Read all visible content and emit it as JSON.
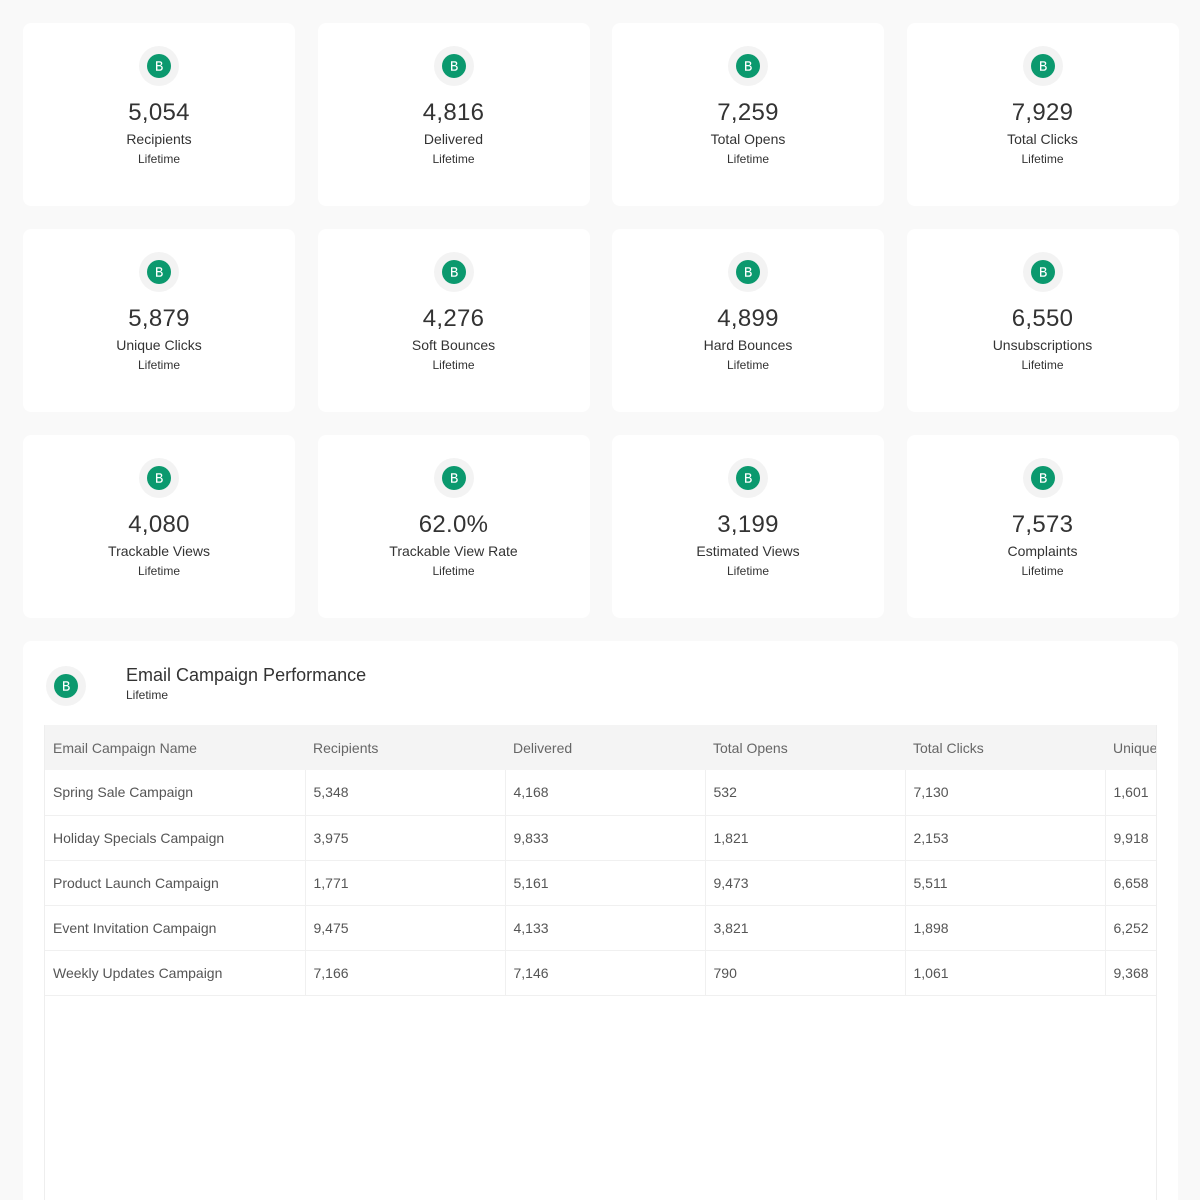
{
  "brand": {
    "accent": "#0b996e",
    "icon": "b-logo-icon"
  },
  "stats": [
    {
      "value": "5,054",
      "label": "Recipients",
      "period": "Lifetime"
    },
    {
      "value": "4,816",
      "label": "Delivered",
      "period": "Lifetime"
    },
    {
      "value": "7,259",
      "label": "Total Opens",
      "period": "Lifetime"
    },
    {
      "value": "7,929",
      "label": "Total Clicks",
      "period": "Lifetime"
    },
    {
      "value": "5,879",
      "label": "Unique Clicks",
      "period": "Lifetime"
    },
    {
      "value": "4,276",
      "label": "Soft Bounces",
      "period": "Lifetime"
    },
    {
      "value": "4,899",
      "label": "Hard Bounces",
      "period": "Lifetime"
    },
    {
      "value": "6,550",
      "label": "Unsubscriptions",
      "period": "Lifetime"
    },
    {
      "value": "4,080",
      "label": "Trackable Views",
      "period": "Lifetime"
    },
    {
      "value": "62.0%",
      "label": "Trackable View Rate",
      "period": "Lifetime"
    },
    {
      "value": "3,199",
      "label": "Estimated Views",
      "period": "Lifetime"
    },
    {
      "value": "7,573",
      "label": "Complaints",
      "period": "Lifetime"
    }
  ],
  "campaigns": {
    "title": "Email Campaign Performance",
    "period": "Lifetime",
    "columns": [
      "Email Campaign Name",
      "Recipients",
      "Delivered",
      "Total Opens",
      "Total Clicks",
      "Unique Clicks"
    ],
    "rows": [
      [
        "Spring Sale Campaign",
        "5,348",
        "4,168",
        "532",
        "7,130",
        "1,601"
      ],
      [
        "Holiday Specials Campaign",
        "3,975",
        "9,833",
        "1,821",
        "2,153",
        "9,918"
      ],
      [
        "Product Launch Campaign",
        "1,771",
        "5,161",
        "9,473",
        "5,511",
        "6,658"
      ],
      [
        "Event Invitation Campaign",
        "9,475",
        "4,133",
        "3,821",
        "1,898",
        "6,252"
      ],
      [
        "Weekly Updates Campaign",
        "7,166",
        "7,146",
        "790",
        "1,061",
        "9,368"
      ]
    ]
  }
}
